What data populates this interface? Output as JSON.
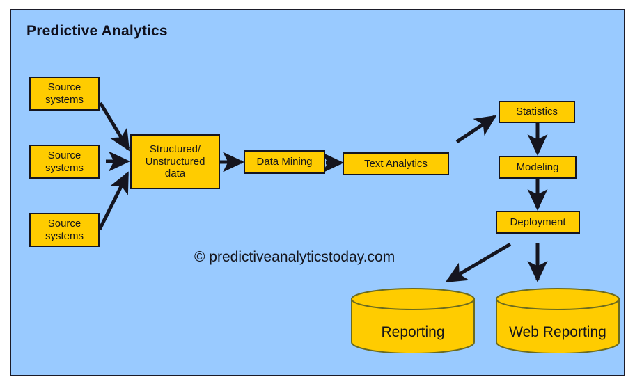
{
  "diagram": {
    "title": "Predictive Analytics",
    "copyright": "© predictiveanalyticstoday.com",
    "colors": {
      "panel_background": "#99caff",
      "node_fill": "#ffcc00",
      "node_border": "#15151f",
      "cylinder_fill": "#ffcc00",
      "cylinder_border": "#6b6b20",
      "arrow": "#15151f",
      "text": "#15151a",
      "page_background": "#ffffff"
    },
    "nodes": [
      {
        "id": "source1",
        "label_line1": "Source",
        "label_line2": "systems",
        "shape": "rectangle"
      },
      {
        "id": "source2",
        "label_line1": "Source",
        "label_line2": "systems",
        "shape": "rectangle"
      },
      {
        "id": "source3",
        "label_line1": "Source",
        "label_line2": "systems",
        "shape": "rectangle"
      },
      {
        "id": "structured",
        "label_line1": "Structured/",
        "label_line2": "Unstructured",
        "label_line3": "data",
        "shape": "rectangle"
      },
      {
        "id": "data_mining",
        "label_line1": "Data Mining",
        "shape": "rectangle"
      },
      {
        "id": "text_analytics",
        "label_line1": "Text Analytics",
        "shape": "rectangle"
      },
      {
        "id": "statistics",
        "label_line1": "Statistics",
        "shape": "rectangle"
      },
      {
        "id": "modeling",
        "label_line1": "Modeling",
        "shape": "rectangle"
      },
      {
        "id": "deployment",
        "label_line1": "Deployment",
        "shape": "rectangle"
      },
      {
        "id": "reporting",
        "label_line1": "Reporting",
        "shape": "cylinder"
      },
      {
        "id": "web_reporting",
        "label_line1": "Web Reporting",
        "shape": "cylinder"
      }
    ],
    "edges": [
      {
        "from": "source1",
        "to": "structured"
      },
      {
        "from": "source2",
        "to": "structured"
      },
      {
        "from": "source3",
        "to": "structured"
      },
      {
        "from": "structured",
        "to": "data_mining"
      },
      {
        "from": "data_mining",
        "to": "text_analytics"
      },
      {
        "from": "text_analytics",
        "to": "statistics"
      },
      {
        "from": "statistics",
        "to": "modeling"
      },
      {
        "from": "modeling",
        "to": "deployment"
      },
      {
        "from": "deployment",
        "to": "reporting"
      },
      {
        "from": "deployment",
        "to": "web_reporting"
      }
    ]
  }
}
